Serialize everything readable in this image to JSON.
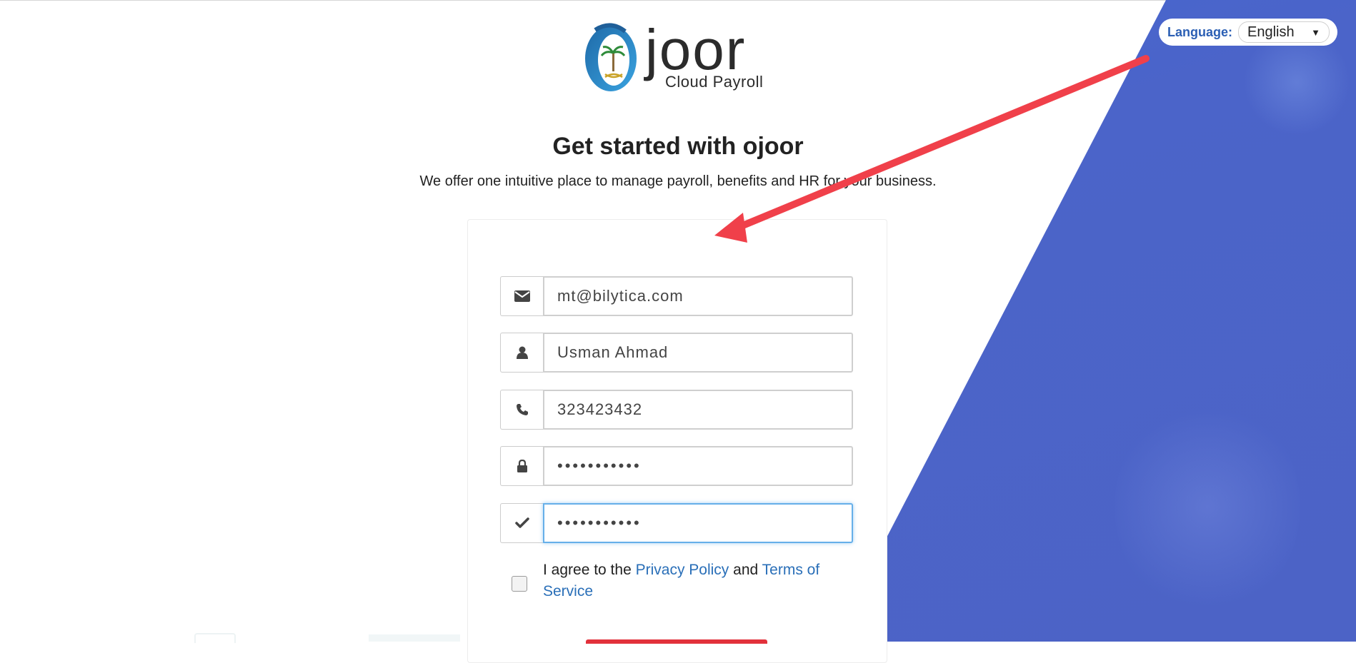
{
  "header": {
    "language_label": "Language:",
    "language_value": "English"
  },
  "logo": {
    "word": "joor",
    "subtitle": "Cloud Payroll"
  },
  "intro": {
    "headline": "Get started with ojoor",
    "subline": "We offer one intuitive place to manage payroll, benefits and HR for your business."
  },
  "form": {
    "email": "mt@bilytica.com",
    "name": "Usman Ahmad",
    "phone": "323423432",
    "password": "•••••••••••",
    "confirm_password": "•••••••••••",
    "agree_prefix": "I agree to the",
    "privacy_link": "Privacy Policy",
    "agree_and": "and",
    "terms_link": "Terms of Service"
  },
  "colors": {
    "accent_blue": "#4b64c9",
    "link": "#2a6fb8",
    "annotation_arrow": "#f0404a",
    "button": "#e2313b"
  },
  "icons": [
    "envelope-icon",
    "user-icon",
    "phone-icon",
    "lock-icon",
    "check-icon",
    "language-caret-icon"
  ]
}
